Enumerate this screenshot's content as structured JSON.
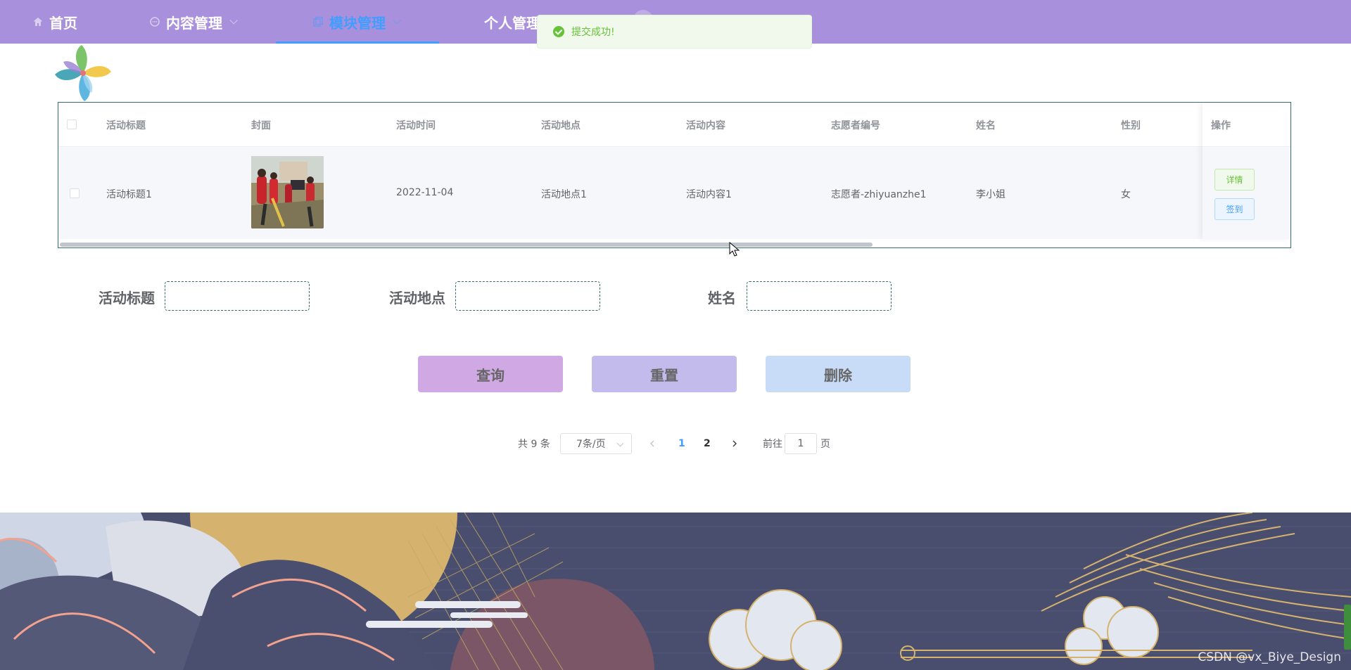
{
  "nav": {
    "home": "首页",
    "content": "内容管理",
    "module": "模块管理",
    "personal": "个人管理"
  },
  "toast": {
    "message": "提交成功!"
  },
  "table": {
    "headers": [
      "活动标题",
      "封面",
      "活动时间",
      "活动地点",
      "活动内容",
      "志愿者编号",
      "姓名",
      "性别",
      "操作"
    ],
    "rows": [
      {
        "title": "活动标题1",
        "time": "2022-11-04",
        "location": "活动地点1",
        "content": "活动内容1",
        "volunteer_id": "志愿者-zhiyuanzhe1",
        "name": "李小姐",
        "gender": "女",
        "detail_label": "详情",
        "sign_label": "签到"
      }
    ]
  },
  "search": {
    "title_label": "活动标题",
    "location_label": "活动地点",
    "name_label": "姓名"
  },
  "buttons": {
    "query": "查询",
    "reset": "重置",
    "delete": "删除"
  },
  "pagination": {
    "total": "共 9 条",
    "page_size": "7条/页",
    "pages": [
      "1",
      "2"
    ],
    "current": "1",
    "goto_label": "前往",
    "goto_value": "1",
    "goto_unit": "页"
  },
  "footer": {
    "watermark": "CSDN @vx_Biye_Design"
  },
  "colors": {
    "nav_bg": "#a990dc",
    "accent": "#409eff",
    "success": "#67c23a",
    "query_btn": "#cfa8e4",
    "reset_btn": "#c4bbed",
    "delete_btn": "#c8dcf8"
  }
}
